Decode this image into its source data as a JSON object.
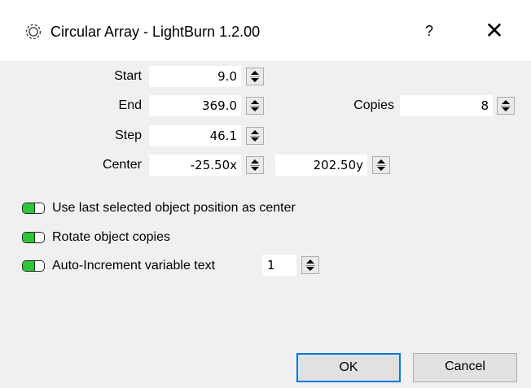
{
  "window": {
    "title": "Circular Array - LightBurn 1.2.00",
    "help_label": "?",
    "close_label": "✕",
    "icon": "gear-icon"
  },
  "fields": {
    "start": {
      "label": "Start",
      "value": "9.0"
    },
    "end": {
      "label": "End",
      "value": "369.0"
    },
    "step": {
      "label": "Step",
      "value": "46.1"
    },
    "center": {
      "label": "Center",
      "x_value": "-25.50x",
      "y_value": "202.50y"
    },
    "copies": {
      "label": "Copies",
      "value": "8"
    }
  },
  "options": {
    "use_last_selected": {
      "label": "Use last selected object position as center",
      "checked": true
    },
    "rotate_copies": {
      "label": "Rotate object copies",
      "checked": true
    },
    "auto_increment": {
      "label": "Auto-Increment variable text",
      "checked": true,
      "value": "1"
    }
  },
  "buttons": {
    "ok_label": "OK",
    "cancel_label": "Cancel"
  },
  "colors": {
    "toggle_on": "#2fc43a",
    "focus_border": "#0078d7"
  }
}
